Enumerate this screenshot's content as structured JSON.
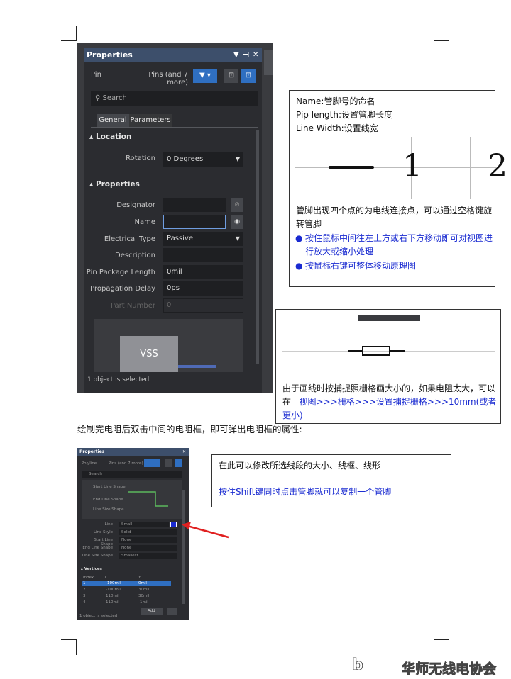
{
  "panel": {
    "title": "Properties",
    "vertical_tab": "Properties",
    "pin_label": "Pin",
    "pin_value": "Pins (and 7 more)",
    "search_placeholder": "Search",
    "tabs": [
      "General",
      "Parameters"
    ],
    "location_header": "Location",
    "rotation_label": "Rotation",
    "rotation_value": "0 Degrees",
    "properties_header": "Properties",
    "designator_label": "Designator",
    "name_label": "Name",
    "electrical_type_label": "Electrical Type",
    "electrical_type_value": "Passive",
    "description_label": "Description",
    "pin_package_length_label": "Pin Package Length",
    "pin_package_length_value": "0mil",
    "propagation_delay_label": "Propagation Delay",
    "propagation_delay_value": "0ps",
    "part_number_label": "Part Number",
    "part_number_value": "0",
    "preview_text": "VSS",
    "status": "1 object is selected"
  },
  "note1": {
    "line1": "Name:管脚号的命名",
    "line2": "Pip length:设置管脚长度",
    "line3": "Line Width:设置线宽",
    "pin1": "1",
    "pin2": "2",
    "para": "管脚出现四个点的为电线连接点，可以通过空格键旋转管脚",
    "bullet1": "按住鼠标中间往左上方或右下方移动即可对视图进行放大或缩小处理",
    "bullet2": "按鼠标右键可整体移动原理图"
  },
  "note2": {
    "text_a": "由于画线时按捕捉照栅格画大小的，如果电阻太大，可以在",
    "text_b": "视图>>>栅格>>>设置捕捉栅格>>>10mm(或者更小)"
  },
  "caption": "绘制完电阻后双击中间的电阻框，即可弹出电阻框的属性:",
  "small_panel": {
    "title": "Properties",
    "pin_label": "Polyline",
    "pin_value": "Pins (and 7 more)",
    "search_placeholder": "Search",
    "shape_labels": [
      "Start Line Shape",
      "End Line Shape",
      "Line Size Shape"
    ],
    "rows": [
      {
        "label": "Line",
        "value": "Small"
      },
      {
        "label": "Line Style",
        "value": "Solid"
      },
      {
        "label": "Start Line Shape",
        "value": "None"
      },
      {
        "label": "End Line Shape",
        "value": "None"
      },
      {
        "label": "Line Size Shape",
        "value": "Smallest"
      }
    ],
    "vertices_header": "Vertices",
    "vertices_cols": [
      "Index",
      "X",
      "Y"
    ],
    "vertices": [
      [
        "1",
        "-100mil",
        "0mil"
      ],
      [
        "2",
        "-100mil",
        "30mil"
      ],
      [
        "3",
        "110mil",
        "30mil"
      ],
      [
        "4",
        "110mil",
        "-1mil"
      ]
    ],
    "add_label": "Add",
    "status": "1 object is selected"
  },
  "note3": {
    "line1": "在此可以修改所选线段的大小、线框、线形",
    "line2": "按住Shift键同时点击管脚就可以复制一个管脚"
  },
  "watermark": "华师无线电协会",
  "colors": {
    "accent": "#2f6fc1",
    "blue_text": "#1a2bd1",
    "arrow": "#e02020"
  }
}
